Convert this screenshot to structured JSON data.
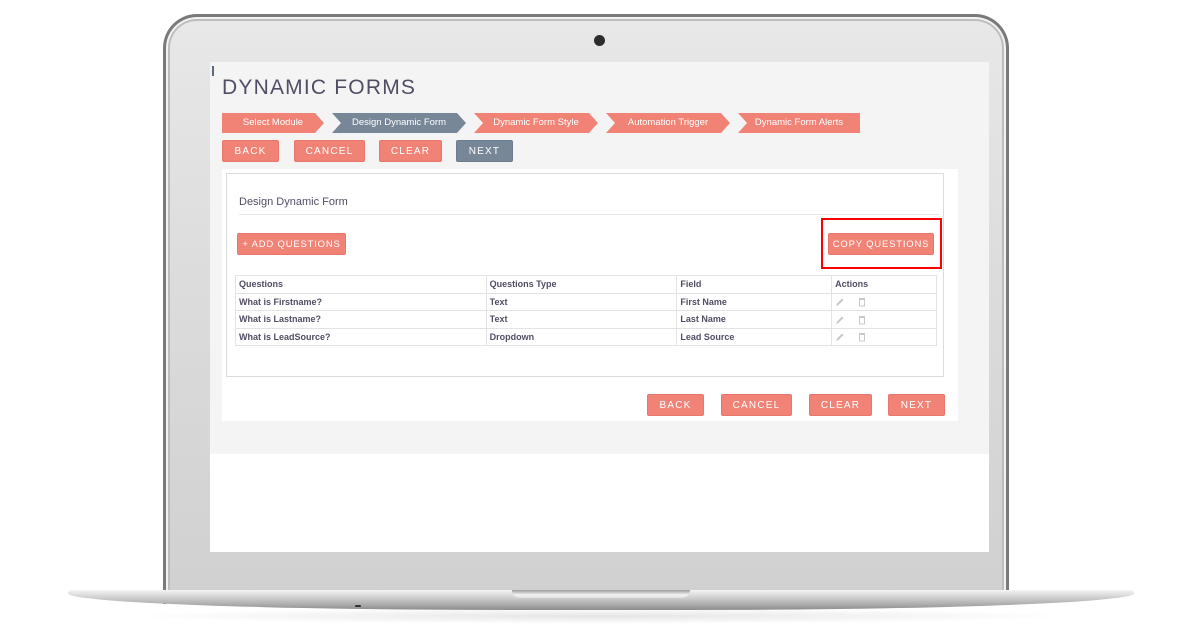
{
  "page": {
    "title": "DYNAMIC FORMS"
  },
  "steps": [
    {
      "label": "Select Module",
      "state": "complete",
      "color": "#f08376"
    },
    {
      "label": "Design Dynamic Form",
      "state": "active",
      "color": "#778797"
    },
    {
      "label": "Dynamic Form Style",
      "state": "pending",
      "color": "#f08376"
    },
    {
      "label": "Automation Trigger",
      "state": "pending",
      "color": "#f08376"
    },
    {
      "label": "Dynamic Form Alerts",
      "state": "pending",
      "color": "#f08376"
    }
  ],
  "top_buttons": {
    "back": "BACK",
    "cancel": "CANCEL",
    "clear": "CLEAR",
    "next": "NEXT"
  },
  "panel": {
    "title": "Design Dynamic Form",
    "add_questions": "+ ADD QUESTIONS",
    "copy_questions": "COPY QUESTIONS"
  },
  "table": {
    "headers": [
      "Questions",
      "Questions Type",
      "Field",
      "Actions"
    ],
    "rows": [
      {
        "question": "What is Firstname?",
        "type": "Text",
        "field": "First Name",
        "actions": [
          "edit-icon",
          "delete-icon"
        ]
      },
      {
        "question": "What is Lastname?",
        "type": "Text",
        "field": "Last Name",
        "actions": [
          "edit-icon",
          "delete-icon"
        ]
      },
      {
        "question": "What is LeadSource?",
        "type": "Dropdown",
        "field": "Lead Source",
        "actions": [
          "edit-icon",
          "delete-icon"
        ]
      }
    ]
  },
  "bottom_buttons": {
    "back": "BACK",
    "cancel": "CANCEL",
    "clear": "CLEAR",
    "next": "NEXT"
  },
  "colors": {
    "accent": "#f08376",
    "active_step": "#778797",
    "highlight": "#ff0000",
    "title_text": "#534d64"
  }
}
